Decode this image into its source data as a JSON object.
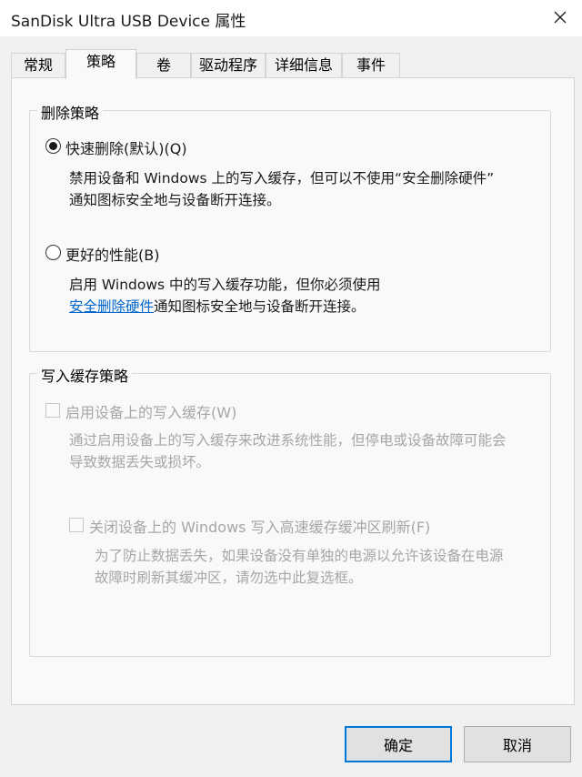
{
  "window": {
    "title": "SanDisk Ultra USB Device 属性",
    "close_icon": "close-icon"
  },
  "tabs": [
    {
      "label": "常规",
      "active": false
    },
    {
      "label": "策略",
      "active": true
    },
    {
      "label": "卷",
      "active": false
    },
    {
      "label": "驱动程序",
      "active": false
    },
    {
      "label": "详细信息",
      "active": false
    },
    {
      "label": "事件",
      "active": false
    }
  ],
  "removal_policy": {
    "title": "删除策略",
    "quick_removal": {
      "label": "快速删除(默认)(Q)",
      "selected": true,
      "desc_line1": "禁用设备和 Windows 上的写入缓存，但可以不使用“安全删除硬件”",
      "desc_line2": "通知图标安全地与设备断开连接。"
    },
    "better_performance": {
      "label": "更好的性能(B)",
      "selected": false,
      "desc_line1": "启用 Windows 中的写入缓存功能，但你必须使用",
      "desc_link": "安全删除硬件",
      "desc_line2_rest": "通知图标安全地与设备断开连接。"
    }
  },
  "write_cache_policy": {
    "title": "写入缓存策略",
    "enable_write_cache": {
      "label": "启用设备上的写入缓存(W)",
      "checked": false,
      "enabled": false,
      "desc_line1": "通过启用设备上的写入缓存来改进系统性能，但停电或设备故障可能会",
      "desc_line2": "导致数据丢失或损坏。"
    },
    "turn_off_flush": {
      "label": "关闭设备上的 Windows 写入高速缓存缓冲区刷新(F)",
      "checked": false,
      "enabled": false,
      "desc_line1": "为了防止数据丢失，如果设备没有单独的电源以允许该设备在电源",
      "desc_line2": "故障时刷新其缓冲区，请勿选中此复选框。"
    }
  },
  "buttons": {
    "ok": "确定",
    "cancel": "取消"
  },
  "colors": {
    "accent": "#0078d7",
    "link": "#0066cc",
    "disabled_text": "#a6a6a6"
  }
}
